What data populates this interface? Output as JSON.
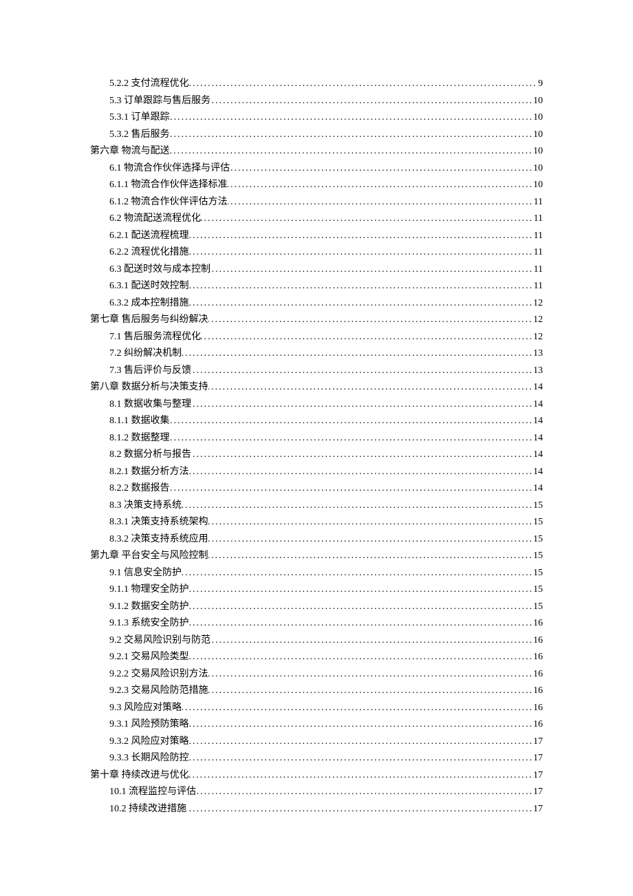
{
  "toc": [
    {
      "level": 2,
      "label": "5.2.2 支付流程优化",
      "page": "9"
    },
    {
      "level": 2,
      "label": "5.3 订单跟踪与售后服务",
      "page": "10"
    },
    {
      "level": 2,
      "label": "5.3.1 订单跟踪",
      "page": "10"
    },
    {
      "level": 2,
      "label": "5.3.2 售后服务",
      "page": "10"
    },
    {
      "level": 1,
      "label": "第六章 物流与配送",
      "page": "10"
    },
    {
      "level": 2,
      "label": "6.1 物流合作伙伴选择与评估",
      "page": "10"
    },
    {
      "level": 2,
      "label": "6.1.1 物流合作伙伴选择标准",
      "page": "10"
    },
    {
      "level": 2,
      "label": "6.1.2 物流合作伙伴评估方法",
      "page": "11"
    },
    {
      "level": 2,
      "label": "6.2 物流配送流程优化",
      "page": "11"
    },
    {
      "level": 2,
      "label": "6.2.1 配送流程梳理",
      "page": "11"
    },
    {
      "level": 2,
      "label": "6.2.2 流程优化措施",
      "page": "11"
    },
    {
      "level": 2,
      "label": "6.3 配送时效与成本控制",
      "page": "11"
    },
    {
      "level": 2,
      "label": "6.3.1 配送时效控制",
      "page": "11"
    },
    {
      "level": 2,
      "label": "6.3.2 成本控制措施",
      "page": "12"
    },
    {
      "level": 1,
      "label": "第七章 售后服务与纠纷解决",
      "page": "12"
    },
    {
      "level": 2,
      "label": "7.1 售后服务流程优化",
      "page": "12"
    },
    {
      "level": 2,
      "label": "7.2 纠纷解决机制",
      "page": "13"
    },
    {
      "level": 2,
      "label": "7.3 售后评价与反馈",
      "page": "13"
    },
    {
      "level": 1,
      "label": "第八章 数据分析与决策支持",
      "page": "14"
    },
    {
      "level": 2,
      "label": "8.1 数据收集与整理",
      "page": "14"
    },
    {
      "level": 2,
      "label": "8.1.1 数据收集",
      "page": "14"
    },
    {
      "level": 2,
      "label": "8.1.2 数据整理",
      "page": "14"
    },
    {
      "level": 2,
      "label": "8.2 数据分析与报告",
      "page": "14"
    },
    {
      "level": 2,
      "label": "8.2.1 数据分析方法",
      "page": "14"
    },
    {
      "level": 2,
      "label": "8.2.2 数据报告",
      "page": "14"
    },
    {
      "level": 2,
      "label": "8.3 决策支持系统",
      "page": "15"
    },
    {
      "level": 2,
      "label": "8.3.1 决策支持系统架构",
      "page": "15"
    },
    {
      "level": 2,
      "label": "8.3.2 决策支持系统应用",
      "page": "15"
    },
    {
      "level": 1,
      "label": "第九章 平台安全与风险控制",
      "page": "15"
    },
    {
      "level": 2,
      "label": "9.1 信息安全防护",
      "page": "15"
    },
    {
      "level": 2,
      "label": "9.1.1 物理安全防护",
      "page": "15"
    },
    {
      "level": 2,
      "label": "9.1.2 数据安全防护",
      "page": "15"
    },
    {
      "level": 2,
      "label": "9.1.3 系统安全防护",
      "page": "16"
    },
    {
      "level": 2,
      "label": "9.2 交易风险识别与防范",
      "page": "16"
    },
    {
      "level": 2,
      "label": "9.2.1 交易风险类型",
      "page": "16"
    },
    {
      "level": 2,
      "label": "9.2.2 交易风险识别方法",
      "page": "16"
    },
    {
      "level": 2,
      "label": "9.2.3 交易风险防范措施",
      "page": "16"
    },
    {
      "level": 2,
      "label": "9.3 风险应对策略",
      "page": "16"
    },
    {
      "level": 2,
      "label": "9.3.1 风险预防策略",
      "page": "16"
    },
    {
      "level": 2,
      "label": "9.3.2 风险应对策略",
      "page": "17"
    },
    {
      "level": 2,
      "label": "9.3.3 长期风险防控",
      "page": "17"
    },
    {
      "level": 1,
      "label": "第十章 持续改进与优化",
      "page": "17"
    },
    {
      "level": 2,
      "label": "10.1 流程监控与评估",
      "page": "17"
    },
    {
      "level": 2,
      "label": "10.2 持续改进措施",
      "page": "17"
    }
  ]
}
